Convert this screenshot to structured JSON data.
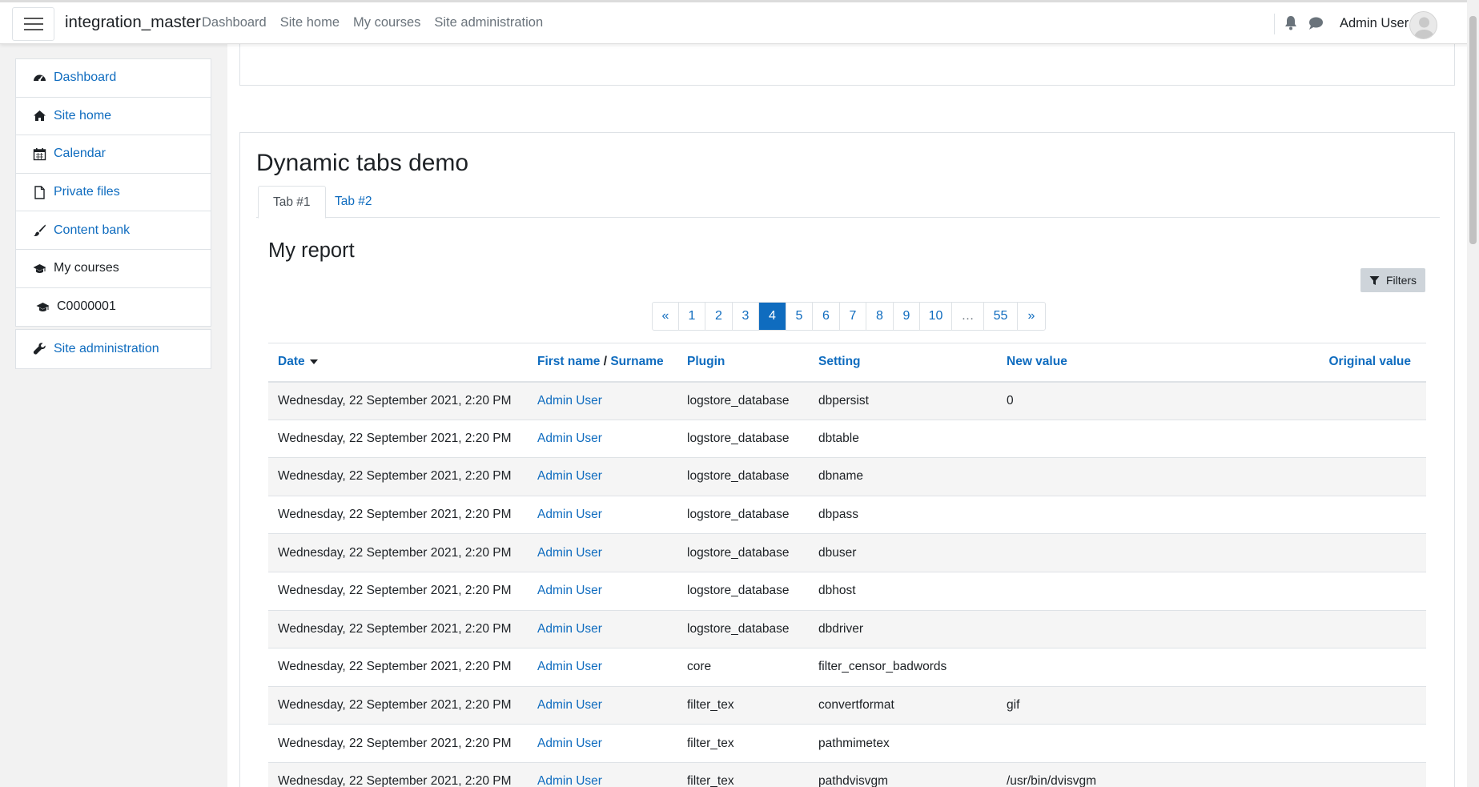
{
  "navbar": {
    "brand": "integration_master",
    "links": [
      "Dashboard",
      "Site home",
      "My courses",
      "Site administration"
    ],
    "user_name": "Admin User"
  },
  "sidebar": {
    "items": [
      {
        "label": "Dashboard",
        "icon": "dashboard-icon"
      },
      {
        "label": "Site home",
        "icon": "home-icon"
      },
      {
        "label": "Calendar",
        "icon": "calendar-icon"
      },
      {
        "label": "Private files",
        "icon": "file-icon"
      },
      {
        "label": "Content bank",
        "icon": "brush-icon"
      },
      {
        "label": "My courses",
        "icon": "graduation-cap-icon"
      },
      {
        "label": "C0000001",
        "icon": "graduation-cap-icon"
      }
    ],
    "admin": {
      "label": "Site administration",
      "icon": "wrench-icon"
    }
  },
  "page": {
    "title": "Dynamic tabs demo",
    "tabs": [
      "Tab #1",
      "Tab #2"
    ],
    "report_title": "My report",
    "filters_label": "Filters"
  },
  "pagination": {
    "items": [
      "«",
      "1",
      "2",
      "3",
      "4",
      "5",
      "6",
      "7",
      "8",
      "9",
      "10",
      "…",
      "55",
      "»"
    ],
    "active": "4"
  },
  "table": {
    "headers": {
      "date": "Date",
      "first_name": "First name",
      "separator": "/",
      "surname": "Surname",
      "plugin": "Plugin",
      "setting": "Setting",
      "new_value": "New value",
      "original_value": "Original value"
    },
    "rows": [
      {
        "date": "Wednesday, 22 September 2021, 2:20 PM",
        "user": "Admin User",
        "plugin": "logstore_database",
        "setting": "dbpersist",
        "new_value": "0",
        "original_value": ""
      },
      {
        "date": "Wednesday, 22 September 2021, 2:20 PM",
        "user": "Admin User",
        "plugin": "logstore_database",
        "setting": "dbtable",
        "new_value": "",
        "original_value": ""
      },
      {
        "date": "Wednesday, 22 September 2021, 2:20 PM",
        "user": "Admin User",
        "plugin": "logstore_database",
        "setting": "dbname",
        "new_value": "",
        "original_value": ""
      },
      {
        "date": "Wednesday, 22 September 2021, 2:20 PM",
        "user": "Admin User",
        "plugin": "logstore_database",
        "setting": "dbpass",
        "new_value": "",
        "original_value": ""
      },
      {
        "date": "Wednesday, 22 September 2021, 2:20 PM",
        "user": "Admin User",
        "plugin": "logstore_database",
        "setting": "dbuser",
        "new_value": "",
        "original_value": ""
      },
      {
        "date": "Wednesday, 22 September 2021, 2:20 PM",
        "user": "Admin User",
        "plugin": "logstore_database",
        "setting": "dbhost",
        "new_value": "",
        "original_value": ""
      },
      {
        "date": "Wednesday, 22 September 2021, 2:20 PM",
        "user": "Admin User",
        "plugin": "logstore_database",
        "setting": "dbdriver",
        "new_value": "",
        "original_value": ""
      },
      {
        "date": "Wednesday, 22 September 2021, 2:20 PM",
        "user": "Admin User",
        "plugin": "core",
        "setting": "filter_censor_badwords",
        "new_value": "",
        "original_value": ""
      },
      {
        "date": "Wednesday, 22 September 2021, 2:20 PM",
        "user": "Admin User",
        "plugin": "filter_tex",
        "setting": "convertformat",
        "new_value": "gif",
        "original_value": ""
      },
      {
        "date": "Wednesday, 22 September 2021, 2:20 PM",
        "user": "Admin User",
        "plugin": "filter_tex",
        "setting": "pathmimetex",
        "new_value": "",
        "original_value": ""
      },
      {
        "date": "Wednesday, 22 September 2021, 2:20 PM",
        "user": "Admin User",
        "plugin": "filter_tex",
        "setting": "pathdvisvgm",
        "new_value": "/usr/bin/dvisvgm",
        "original_value": ""
      }
    ]
  }
}
